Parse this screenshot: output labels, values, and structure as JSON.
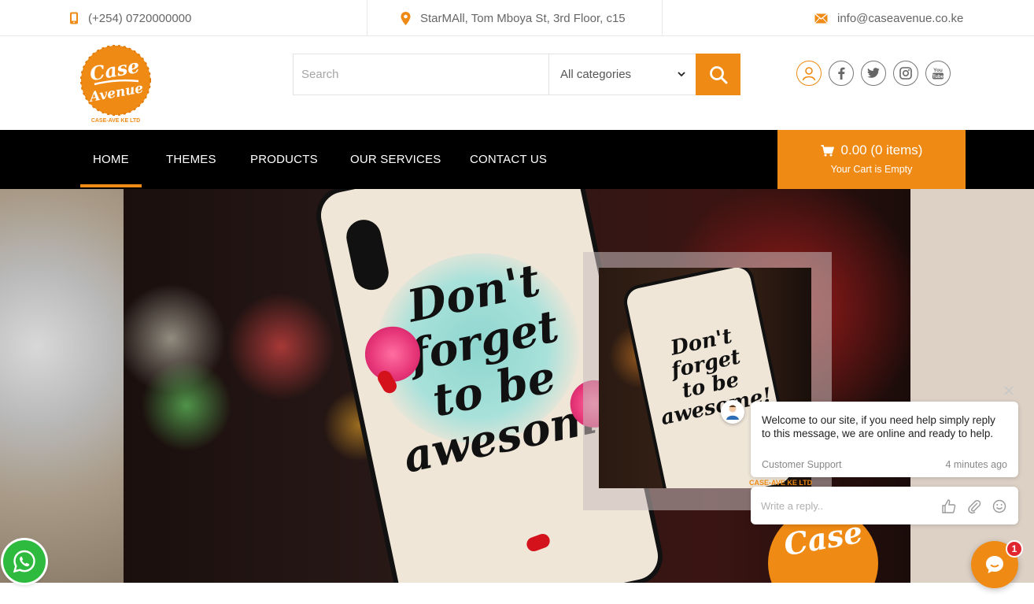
{
  "topbar": {
    "phone": "(+254) 0720000000",
    "address": "StarMAll, Tom Mboya St, 3rd Floor, c15",
    "email": "info@caseavenue.co.ke"
  },
  "header": {
    "logo_line1": "Case",
    "logo_line2": "Avenue",
    "logo_sub": "CASE-AVE KE LTD",
    "search_placeholder": "Search",
    "category_selected": "All categories",
    "social_icons": [
      "user-icon",
      "facebook-icon",
      "twitter-icon",
      "instagram-icon",
      "youtube-icon"
    ]
  },
  "nav": {
    "items": [
      {
        "label": "HOME",
        "active": true
      },
      {
        "label": "THEMES",
        "active": false
      },
      {
        "label": "PRODUCTS",
        "active": false
      },
      {
        "label": "OUR SERVICES",
        "active": false
      },
      {
        "label": "CONTACT US",
        "active": false
      }
    ],
    "cart_amount": "0.00 (0 items)",
    "cart_status": "Your Cart is Empty"
  },
  "hero": {
    "quote_line1": "Don't",
    "quote_line2": "forget",
    "quote_line3": "to be",
    "quote_line4": "awesome!",
    "brand_label": "CASE-AVE KE LTD",
    "brand_word": "Case"
  },
  "chat": {
    "message": "Welcome to our site, if you need help simply reply to this message, we are online and ready to help.",
    "sender": "Customer Support",
    "time": "4 minutes ago",
    "reply_placeholder": "Write a reply..",
    "unread_count": "1"
  },
  "colors": {
    "accent": "#ef8a14",
    "nav_bg": "#000000",
    "whatsapp": "#2dba3f",
    "badge": "#e0262f"
  }
}
